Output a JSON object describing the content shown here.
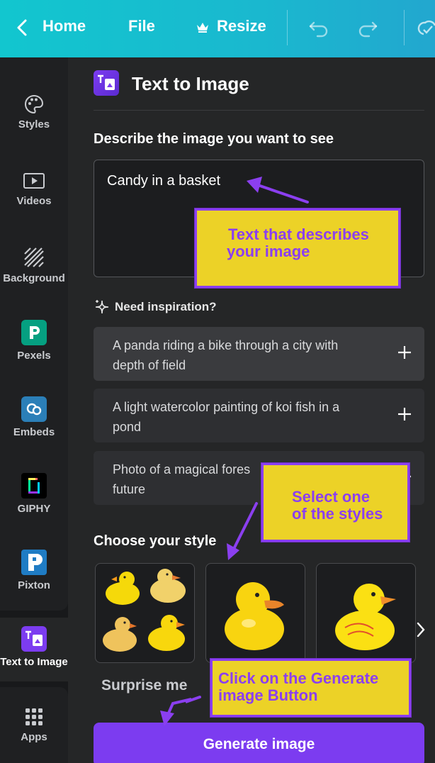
{
  "topbar": {
    "home_label": "Home",
    "file_label": "File",
    "resize_label": "Resize",
    "icons": [
      "chevron-left-icon",
      "crown-icon",
      "undo-icon",
      "redo-icon",
      "cloud-check-icon"
    ]
  },
  "sidebar": {
    "items": [
      {
        "label": "Styles",
        "icon": "palette-icon"
      },
      {
        "label": "Videos",
        "icon": "video-icon"
      },
      {
        "label": "Background",
        "icon": "background-pattern-icon"
      },
      {
        "label": "Pexels",
        "icon": "pexels-icon"
      },
      {
        "label": "Embeds",
        "icon": "embeds-icon"
      },
      {
        "label": "GIPHY",
        "icon": "giphy-icon"
      },
      {
        "label": "Pixton",
        "icon": "pixton-icon"
      },
      {
        "label": "Text to Image",
        "icon": "text-to-image-icon"
      },
      {
        "label": "Apps",
        "icon": "apps-grid-icon"
      }
    ]
  },
  "panel": {
    "title": "Text to Image",
    "describe_heading": "Describe the image you want to see",
    "prompt_value": "Candy in a basket",
    "inspiration_label": "Need inspiration?",
    "suggestions": [
      {
        "line1": "A panda riding a bike through a city with",
        "line2": "depth of field"
      },
      {
        "line1": "A light watercolor painting of koi fish in a",
        "line2": "pond"
      },
      {
        "line1": "Photo of a magical fores",
        "line2": "future"
      }
    ],
    "style_heading": "Choose your style",
    "surprise_label": "Surprise me",
    "generate_label": "Generate image"
  },
  "callouts": {
    "describe": {
      "line1": "Text that describes",
      "line2": "your image"
    },
    "styles": {
      "line1": "Select one",
      "line2": "of the styles"
    },
    "generate": {
      "line1": "Click on the Generate",
      "line2": "image Button"
    }
  },
  "colors": {
    "topbar_start": "#12c6cf",
    "topbar_end": "#22a7cf",
    "accent": "#7c3cf0",
    "callout_bg": "#ecd227",
    "callout_border": "#8b3ff0"
  }
}
